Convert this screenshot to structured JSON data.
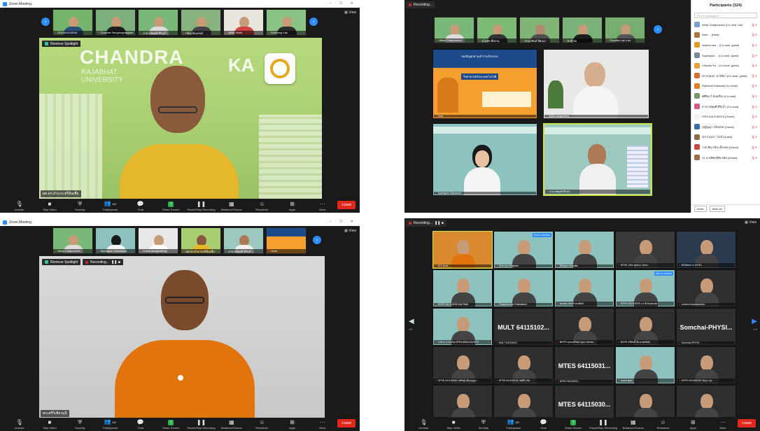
{
  "q1": {
    "window_title": "Zoom Meeting",
    "view_label": "View",
    "thumbs": [
      "EDU641115044",
      "Chanida Sangtongrangsar",
      "อาจารย์ยุพดี ศิริแก้ว",
      "กนิน อินแลนด์",
      "Affair Hunk",
      "Eubhong Lao"
    ],
    "spot_tag": "Remove Spotlight",
    "spot_brand_top": "CHANDRA",
    "spot_brand_mid": "RAJABHAT UNIVERSITY",
    "spot_brand_right": "KA",
    "spot_name": "ผศ.ดร.อำนาจ ศรีอ้นเชื่อ"
  },
  "q2": {
    "rec_label": "Recording...",
    "participants_title": "Participants (324)",
    "search_placeholder": "Find a participant",
    "thumbs": [
      "Wirat Chatprowich",
      "อโนทัย พึ่งยาม",
      "ปวนาชันห์ สีดเนร",
      "ชาติ ชม",
      "Parattiw Lab Lee"
    ],
    "tiles": [
      {
        "name": "Host"
      },
      {
        "name": "chalot sangtsuteng"
      },
      {
        "name": "Suphapon Sakulworn"
      },
      {
        "name": "อาจารย์ยุพดี ศิริแก้ว"
      }
    ],
    "slide_title": "ขอเชิญทุกท่านเข้าร่วมกิจกรรม",
    "slide_sub": "วิทยาศาสตร์และเทคโนโลยี",
    "participants": [
      {
        "name": "Wirat Chatprowich (Co-host, me)",
        "color": "#7aa0c8"
      },
      {
        "name": "Host ... (Host)",
        "color": "#b0733a"
      },
      {
        "name": "chainin san... (Co-host, guest)",
        "color": "#e09a2c"
      },
      {
        "name": "Suphapon ... (Co-host, guest)",
        "color": "#7a8a99"
      },
      {
        "name": "Chanita Sa... (Co-host, guest)",
        "color": "#e8a13a"
      },
      {
        "name": "ดร.กฤษณา ปารษิดา (Co-host, guest)",
        "color": "#d06f2c"
      },
      {
        "name": "Ratchida Sukswan (Co-host)",
        "color": "#e07f2a"
      },
      {
        "name": "ศศิธิมาร์ อ้มมสีกอ (Co-host)",
        "color": "#6f9a66"
      },
      {
        "name": "อาจารย์ยุพดี ศิริแก้ว (Co-host)",
        "color": "#d75a8a"
      },
      {
        "name": "ITEN 641115097A (Guest)",
        "color": "#f2f2f2"
      },
      {
        "name": "(ปฏิญญา กริษม์รท (Guest)",
        "color": "#3b6ea5"
      },
      {
        "name": "3073 อนรา โกเจ้ (Guest)",
        "color": "#8f6f4a"
      },
      {
        "name": "T3S ทิญ กลิน เบิ้งภอย (Guest)",
        "color": "#cc4444"
      },
      {
        "name": "31 นายพิษณ์ทิพ สมัส (Guest)",
        "color": "#a06b4c"
      }
    ],
    "footer": [
      "Invite",
      "Mute All"
    ]
  },
  "q3": {
    "window_title": "Zoom Meeting",
    "view_label": "View",
    "thumbs": [
      "Wirat Chatprowich",
      "Suphapon Sakulworn",
      "chalot sangtsuteng",
      "ผศ.ดร.อำนาจ ศรีอ้นเชื่อ",
      "อาจารย์ยุพดี ศิริแก้ว",
      "Host"
    ],
    "spot_tag": "Remove Spotlight",
    "rec_label": "Recording...",
    "spot_name": "พระศรีวิเชียรมุนี"
  },
  "q4": {
    "rec_label": "Recording...",
    "grid": [
      [
        "SCI Host",
        "Somchai Singham",
        "Baliaya Utumalin",
        "SPSS 1304 ยุทธนา จันดา",
        "B208ผลการ สำเริ่ม"
      ],
      [
        "MTES 641115036 Kiat Rath",
        "Thuwanondar Ratanakum",
        "ชนกพร จันทร์ ทรงศิลป์",
        "MTES 641115075 กวานิ Euanrota",
        "phacha kaiyasanahor"
      ],
      [
        "วรชาง นาชมริม-SPPA 650014115070",
        "MULT 64115102...",
        "BKPS ของมณีรัตน์ ตุยการพรหม",
        "BKPS ทวีศักดิ์ อ้นนายทรัพย์",
        "Somchai-PHYSI..."
      ],
      [
        "SPSS 641150049 กษิรัษฐ์ เสือบุญญา",
        "SPSS 641150126 ภัคศิริ กริส",
        "MTES 64115031...",
        "จนพล พุทธ",
        "MTES 641150028 วัฒนา สุจ"
      ],
      [
        "T323 นิฐุลษ์ สิงหนาร",
        "MTES 641150038 วิทยะ โพธิศ",
        "MTES 64115030...",
        "ศิริชัย พันธ์ ชอม",
        "SPSS 6411502E0 กษิพิมพ์ อินสร์"
      ]
    ],
    "view_label": "View",
    "unmute_btn": "Ask to Unmute",
    "side_num_left": "1/3",
    "side_num_right": "1/3"
  },
  "toolbar": {
    "items": [
      "Unmute",
      "Stop Video",
      "Security",
      "Participants",
      "Chat",
      "Share Screen",
      "Pause/Stop Recording",
      "Breakout Rooms",
      "Reactions",
      "Apps",
      "More"
    ],
    "participants_count": "182",
    "leave": "Leave"
  }
}
